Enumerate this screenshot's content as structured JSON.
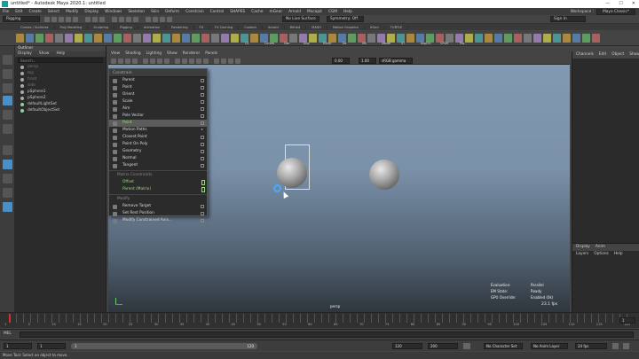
{
  "window": {
    "title": "untitled* - Autodesk Maya 2020.1: untitled",
    "min": "—",
    "max": "☐",
    "close": "✕"
  },
  "menubar": [
    "File",
    "Edit",
    "Create",
    "Select",
    "Modify",
    "Display",
    "Windows",
    "Skeleton",
    "Skin",
    "Deform",
    "Constrain",
    "Control",
    "SHAPES",
    "Cache",
    "mGear",
    "Arnold",
    "Mocapit",
    "CGM",
    "Help"
  ],
  "workspace": {
    "label": "Workspace :",
    "value": "Maya Classic*"
  },
  "statusline": {
    "menuset": "Rigging",
    "live_surface": "No Live Surface",
    "symmetry": "Symmetry: Off",
    "signin": "Sign In"
  },
  "shelf_tabs": [
    "Curves / Surfaces",
    "Poly Modeling",
    "Sculpting",
    "Rigging",
    "Animation",
    "Rendering",
    "FX",
    "FX Caching",
    "Custom",
    "Arnold",
    "Bifrost",
    "MASH",
    "Motion Graphics",
    "XGen",
    "TURTLE"
  ],
  "shelf_labels": [
    "CS",
    "Curves",
    "Gen",
    "Dup",
    "Mirror",
    "Dir",
    "XM",
    "sNode",
    "XT",
    "AvgCrv",
    "CPSM",
    "Pos"
  ],
  "outliner": {
    "title": "Outliner",
    "menu": [
      "Display",
      "Show",
      "Help"
    ],
    "search_placeholder": "Search...",
    "items": [
      {
        "label": "persp",
        "dim": true
      },
      {
        "label": "top",
        "dim": true
      },
      {
        "label": "front",
        "dim": true
      },
      {
        "label": "side",
        "dim": true
      },
      {
        "label": "pSphere1",
        "dim": false
      },
      {
        "label": "pSphere2",
        "dim": false
      },
      {
        "label": "defaultLightSet",
        "dim": false
      },
      {
        "label": "defaultObjectSet",
        "dim": false
      }
    ]
  },
  "viewport": {
    "menu": [
      "View",
      "Shading",
      "Lighting",
      "Show",
      "Renderer",
      "Panels"
    ],
    "field_a": "0.00",
    "field_b": "1.00",
    "colorspace": "sRGB gamma",
    "camera_label": "persp",
    "hud": [
      {
        "label": "Evaluation:",
        "value": "Parallel"
      },
      {
        "label": "EM State:",
        "value": "Ready"
      },
      {
        "label": "GPU Override:",
        "value": "Enabled (0k)"
      }
    ],
    "fps": "23.1 fps"
  },
  "constrain_menu": {
    "header": "Constrain",
    "items": [
      {
        "label": "Parent",
        "type": "item"
      },
      {
        "label": "Point",
        "type": "item"
      },
      {
        "label": "Orient",
        "type": "item"
      },
      {
        "label": "Scale",
        "type": "item"
      },
      {
        "label": "Aim",
        "type": "item"
      },
      {
        "label": "Pole Vector",
        "type": "item"
      },
      {
        "label": "Point",
        "type": "highlight"
      },
      {
        "label": "Motion Paths",
        "type": "sub"
      },
      {
        "label": "Closest Point",
        "type": "item"
      },
      {
        "label": "Point On Poly",
        "type": "item"
      },
      {
        "label": "Geometry",
        "type": "item"
      },
      {
        "label": "Normal",
        "type": "item"
      },
      {
        "label": "Tangent",
        "type": "item"
      },
      {
        "label": "Matrix Constraints",
        "type": "section"
      },
      {
        "label": "Offset",
        "type": "green"
      },
      {
        "label": "Parent (Matrix)",
        "type": "green"
      },
      {
        "label": "Modify",
        "type": "section"
      },
      {
        "label": "Remove Target",
        "type": "item"
      },
      {
        "label": "Set Rest Position",
        "type": "item"
      },
      {
        "label": "Modify Constrained Axis...",
        "type": "item"
      }
    ]
  },
  "channelbox": {
    "tabs": [
      "Channels",
      "Edit",
      "Object",
      "Show"
    ]
  },
  "layers": {
    "tabs": [
      "Display",
      "Anim"
    ],
    "menu": [
      "Layers",
      "Options",
      "Help"
    ]
  },
  "timeline": {
    "ticks": [
      "1",
      "5",
      "10",
      "15",
      "20",
      "25",
      "30",
      "35",
      "40",
      "45",
      "50",
      "55",
      "60",
      "65",
      "70",
      "75",
      "80",
      "85",
      "90",
      "95",
      "100",
      "105",
      "110",
      "115",
      "120"
    ],
    "current": "1"
  },
  "mel": {
    "label": "MEL"
  },
  "range": {
    "start": "1",
    "start2": "1",
    "slider_value": "1",
    "end": "120",
    "end2": "120",
    "end3": "200",
    "char_set": "No Character Set",
    "anim_layer": "No Anim Layer",
    "fps": "24 fps"
  },
  "helpline": "Move Tool: Select an object to move."
}
